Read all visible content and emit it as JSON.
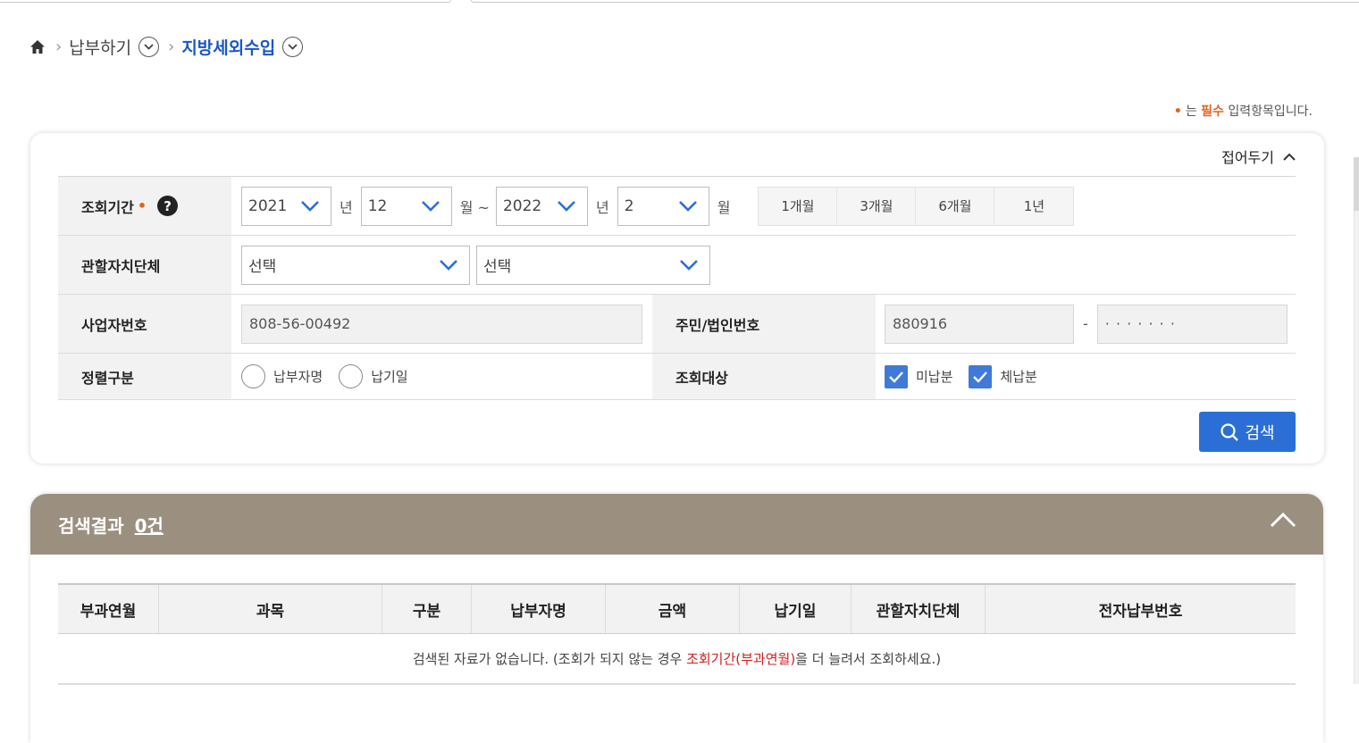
{
  "breadcrumb": {
    "home_icon": "home-icon",
    "items": [
      "납부하기",
      "지방세외수입"
    ]
  },
  "required_note": {
    "dot": "•",
    "pre": "는",
    "required": "필수",
    "post": "입력항목입니다."
  },
  "search_form": {
    "collapse_label": "접어두기",
    "period": {
      "label": "조회기간",
      "required_dot": "•",
      "help": "?",
      "start_year": "2021",
      "year_unit": "년",
      "start_month": "12",
      "month_unit_range": "월 ~",
      "end_year": "2022",
      "end_month": "2",
      "month_unit": "월",
      "quick_buttons": [
        "1개월",
        "3개월",
        "6개월",
        "1년"
      ]
    },
    "jurisdiction": {
      "label": "관할자치단체",
      "select1": "선택",
      "select2": "선택"
    },
    "business_no": {
      "label": "사업자번호",
      "value": "808-56-00492"
    },
    "resident_no": {
      "label": "주민/법인번호",
      "front": "880916",
      "dash": "-",
      "back": "· · · · · · ·"
    },
    "sort": {
      "label": "정렬구분",
      "options": [
        "납부자명",
        "납기일"
      ]
    },
    "target": {
      "label": "조회대상",
      "options": [
        "미납분",
        "체납분"
      ],
      "checked": [
        true,
        true
      ]
    },
    "search_button": "검색"
  },
  "results": {
    "title": "검색결과",
    "count": "0건",
    "columns": [
      "부과연월",
      "과목",
      "구분",
      "납부자명",
      "금액",
      "납기일",
      "관할자치단체",
      "전자납부번호"
    ],
    "empty_pre": "검색된 자료가 없습니다. (조회가 되지 않는 경우",
    "empty_highlight": "조회기간(부과연월)",
    "empty_post": "을 더 늘려서 조회하세요.)"
  },
  "colors": {
    "accent": "#2b6fd6",
    "breadcrumb_current": "#1a56c8",
    "required": "#e5621c",
    "results_header": "#9b9080",
    "checkbox": "#3f7ad8"
  }
}
